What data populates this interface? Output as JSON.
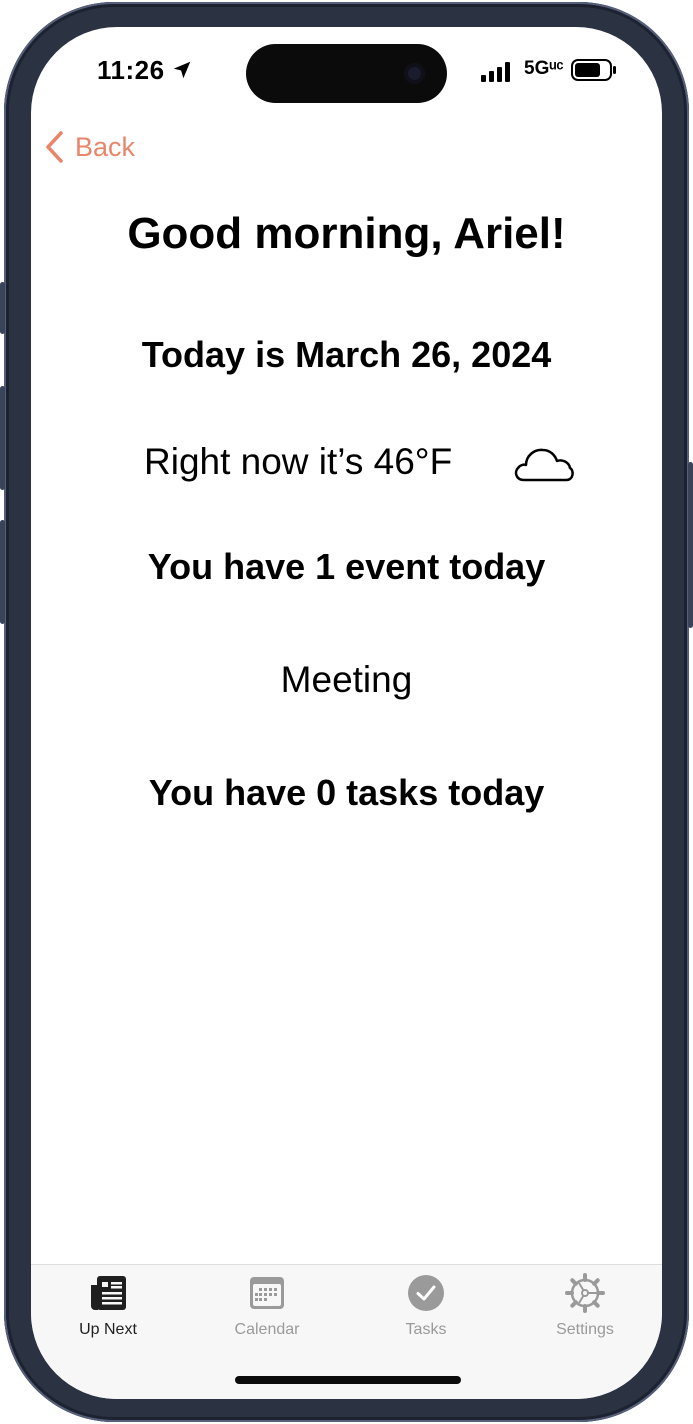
{
  "status_bar": {
    "time": "11:26",
    "network": "5Gᵘᶜ"
  },
  "nav": {
    "back_label": "Back"
  },
  "content": {
    "greeting": "Good morning, Ariel!",
    "date_line": "Today is March 26, 2024",
    "weather_text": "Right now it’s 46°F",
    "weather_icon": "cloud-icon",
    "events_summary": "You have 1 event today",
    "events": [
      "Meeting"
    ],
    "tasks_summary": "You have 0 tasks today"
  },
  "tab_bar": {
    "tabs": [
      {
        "label": "Up Next",
        "icon": "newspaper-icon",
        "active": true
      },
      {
        "label": "Calendar",
        "icon": "calendar-icon",
        "active": false
      },
      {
        "label": "Tasks",
        "icon": "checkmark-circle-icon",
        "active": false
      },
      {
        "label": "Settings",
        "icon": "gear-icon",
        "active": false
      }
    ]
  },
  "colors": {
    "accent": "#e9866a",
    "active_tab": "#1f1f1f",
    "inactive_tab": "#9a9a9a"
  }
}
